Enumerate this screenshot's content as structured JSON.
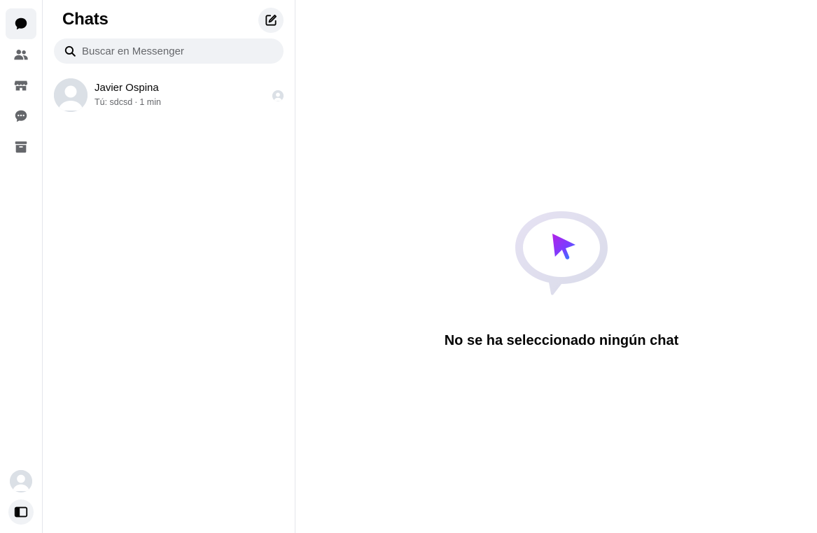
{
  "rail": {
    "items": [
      {
        "name": "chats",
        "icon": "chat-bubble-icon",
        "active": true
      },
      {
        "name": "people",
        "icon": "people-icon",
        "active": false
      },
      {
        "name": "marketplace",
        "icon": "store-icon",
        "active": false
      },
      {
        "name": "requests",
        "icon": "message-dots-icon",
        "active": false
      },
      {
        "name": "archived",
        "icon": "archive-icon",
        "active": false
      }
    ],
    "profile_icon": "avatar",
    "toggle_icon": "sidebar-toggle-icon"
  },
  "panel": {
    "title": "Chats",
    "compose_icon": "compose-icon",
    "search": {
      "placeholder": "Buscar en Messenger",
      "value": ""
    },
    "chats": [
      {
        "name": "Javier Ospina",
        "last_message": "Tú: sdcsd",
        "time": "1 min",
        "seen": true
      }
    ]
  },
  "main": {
    "empty_message": "No se ha seleccionado ningún chat"
  },
  "colors": {
    "accent_gradient_start": "#a033ff",
    "accent_gradient_end": "#0a7cff",
    "text_primary": "#050505",
    "text_secondary": "#65676b",
    "surface": "#f0f2f5"
  }
}
